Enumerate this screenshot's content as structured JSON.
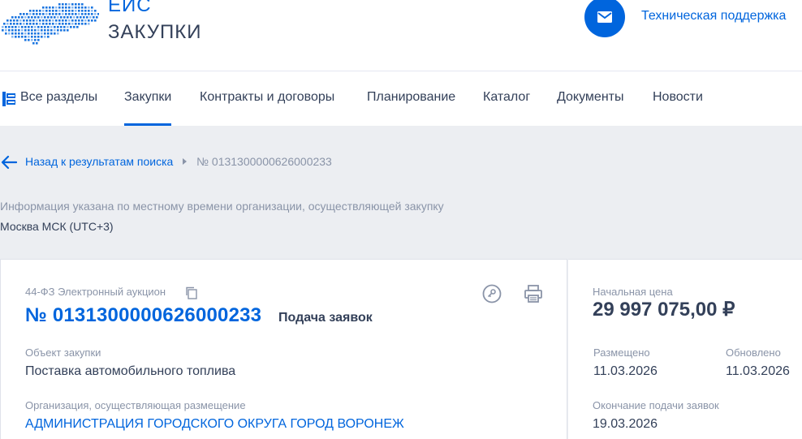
{
  "header": {
    "logo_line1": "ЕИС",
    "logo_line2": "ЗАКУПКИ",
    "support_icon": "envelope-icon",
    "support_label": "Техническая поддержка",
    "brand_color": "#0065dd"
  },
  "nav": {
    "all_sections_icon": "sections-icon",
    "items": [
      {
        "label": "Все разделы"
      },
      {
        "label": "Закупки",
        "active": true
      },
      {
        "label": "Контракты и договоры"
      },
      {
        "label": "Планирование"
      },
      {
        "label": "Каталог"
      },
      {
        "label": "Документы"
      },
      {
        "label": "Новости"
      }
    ]
  },
  "breadcrumb": {
    "back_icon": "arrow-left-icon",
    "back_label": "Назад к результатам поиска",
    "current": "№ 0131300000626000233"
  },
  "timezone": {
    "info": "Информация указана по местному времени организации, осуществляющей закупку",
    "value": "Москва МСК (UTC+3)"
  },
  "purchase": {
    "type": "44-ФЗ Электронный аукцион",
    "copy_icon": "copy-icon",
    "number": "№ 0131300000626000233",
    "status": "Подача заявок",
    "key_icon": "key-icon",
    "print_icon": "printer-icon",
    "object_label": "Объект закупки",
    "object_value": "Поставка автомобильного топлива",
    "org_label": "Организация, осуществляющая размещение",
    "org_value": "АДМИНИСТРАЦИЯ ГОРОДСКОГО ОКРУГА ГОРОД ВОРОНЕЖ"
  },
  "side": {
    "price_label": "Начальная цена",
    "price_value": "29 997 075,00 ₽",
    "placed_label": "Размещено",
    "placed_value": "11.03.2026",
    "updated_label": "Обновлено",
    "updated_value": "11.03.2026",
    "deadline_label": "Окончание подачи заявок",
    "deadline_value": "19.03.2026"
  }
}
